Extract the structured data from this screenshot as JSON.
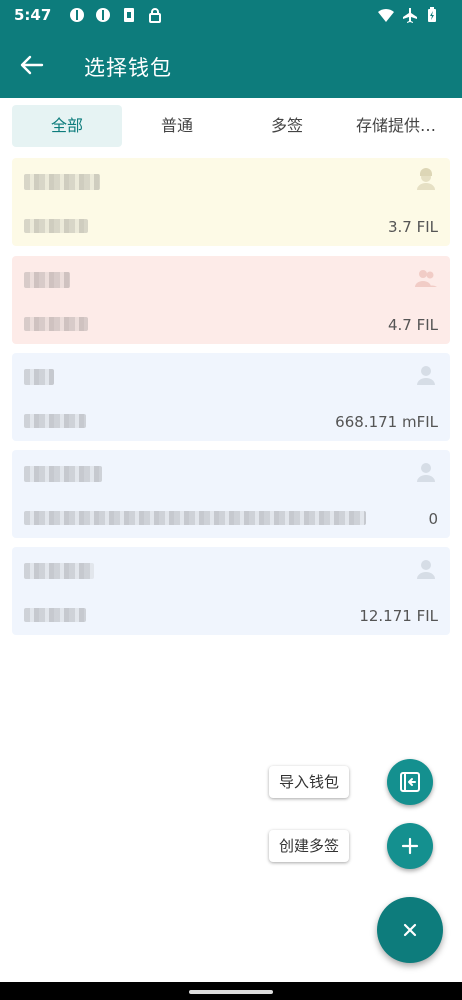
{
  "status_bar": {
    "time": "5:47"
  },
  "app_bar": {
    "title": "选择钱包"
  },
  "tabs": [
    {
      "label": "全部",
      "active": true
    },
    {
      "label": "普通",
      "active": false
    },
    {
      "label": "多签",
      "active": false
    },
    {
      "label": "存储提供…",
      "active": false
    }
  ],
  "wallets": [
    {
      "balance": "3.7 FIL",
      "bg": "#fdfae6",
      "icon": "worker-icon"
    },
    {
      "balance": "4.7 FIL",
      "bg": "#fdebe8",
      "icon": "multi-user-icon"
    },
    {
      "balance": "668.171 mFIL",
      "bg": "#f0f5fd",
      "icon": "user-icon"
    },
    {
      "balance": "0",
      "bg": "#f0f5fd",
      "icon": "user-icon"
    },
    {
      "balance": "12.171 FIL",
      "bg": "#f0f5fd",
      "icon": "user-icon"
    }
  ],
  "fab": {
    "import_label": "导入钱包",
    "create_multisig_label": "创建多签"
  },
  "colors": {
    "primary": "#0d7c7c",
    "fab_small": "#14908f"
  }
}
